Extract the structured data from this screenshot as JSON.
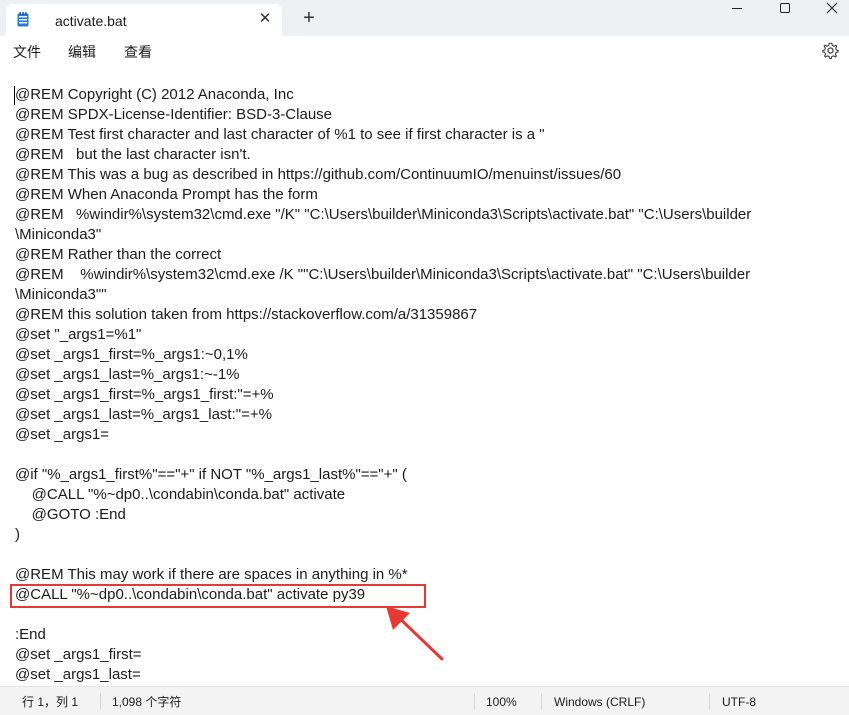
{
  "window": {
    "tab_title": "activate.bat",
    "tab_close": "✕",
    "new_tab": "+",
    "min": "—",
    "max": "☐",
    "close": "✕"
  },
  "menu": {
    "file": "文件",
    "edit": "编辑",
    "view": "查看"
  },
  "editor": {
    "lines": [
      "@REM Copyright (C) 2012 Anaconda, Inc",
      "@REM SPDX-License-Identifier: BSD-3-Clause",
      "@REM Test first character and last character of %1 to see if first character is a \"",
      "@REM   but the last character isn't.",
      "@REM This was a bug as described in https://github.com/ContinuumIO/menuinst/issues/60",
      "@REM When Anaconda Prompt has the form",
      "@REM   %windir%\\system32\\cmd.exe \"/K\" \"C:\\Users\\builder\\Miniconda3\\Scripts\\activate.bat\" \"C:\\Users\\builder",
      "\\Miniconda3\"",
      "@REM Rather than the correct",
      "@REM    %windir%\\system32\\cmd.exe /K \"\"C:\\Users\\builder\\Miniconda3\\Scripts\\activate.bat\" \"C:\\Users\\builder",
      "\\Miniconda3\"\"",
      "@REM this solution taken from https://stackoverflow.com/a/31359867",
      "@set \"_args1=%1\"",
      "@set _args1_first=%_args1:~0,1%",
      "@set _args1_last=%_args1:~-1%",
      "@set _args1_first=%_args1_first:\"=+%",
      "@set _args1_last=%_args1_last:\"=+%",
      "@set _args1=",
      "",
      "@if \"%_args1_first%\"==\"+\" if NOT \"%_args1_last%\"==\"+\" (",
      "    @CALL \"%~dp0..\\condabin\\conda.bat\" activate",
      "    @GOTO :End",
      ")",
      "",
      "@REM This may work if there are spaces in anything in %*",
      "@CALL \"%~dp0..\\condabin\\conda.bat\" activate py39",
      "",
      ":End",
      "@set _args1_first=",
      "@set _args1_last="
    ]
  },
  "status": {
    "position": "行 1，列 1",
    "char_count": "1,098 个字符",
    "zoom": "100%",
    "line_ending": "Windows (CRLF)",
    "encoding": "UTF-8"
  },
  "colors": {
    "highlight": "#e53935",
    "titlebar": "#eef0f4"
  }
}
